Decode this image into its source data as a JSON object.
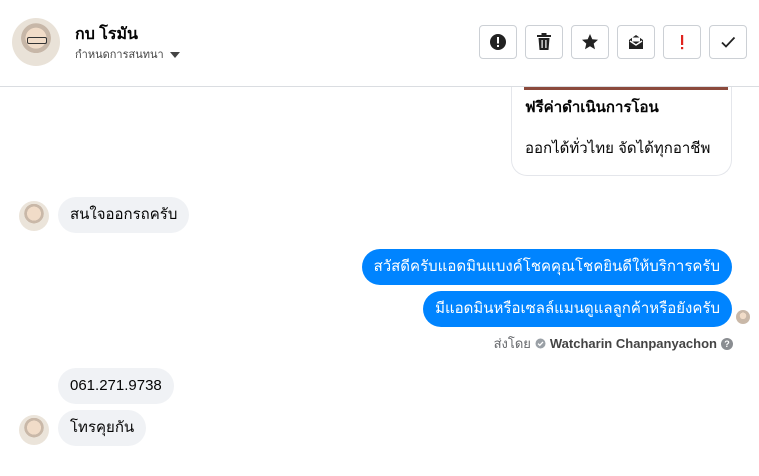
{
  "header": {
    "contact_name": "กบ โรมัน",
    "subtitle": "กำหนดการสนทนา",
    "tools": [
      "alert-circle-icon",
      "trash-icon",
      "star-icon",
      "mark-unread-icon",
      "important-icon",
      "check-icon"
    ]
  },
  "card": {
    "title": "ฟรีค่าดำเนินการโอน",
    "desc": "ออกได้ทั่วไทย จัดได้ทุกอาชีพ"
  },
  "messages": {
    "in_1": "สนใจออกรถครับ",
    "out_1": "สวัสดีครับแอดมินแบงค์โชคคุณโชคยินดีให้บริการครับ",
    "out_2": "มีแอดมินหรือเซลล์แมนดูแลลูกค้าหรือยังครับ",
    "in_2": "061.271.9738",
    "in_3": "โทรคุยกัน"
  },
  "sent_by": {
    "label": "ส่งโดย",
    "name": "Watcharin Chanpanyachon",
    "help": "?"
  },
  "colors": {
    "outgoing": "#0084ff",
    "incoming": "#f0f2f5",
    "important": "#e0241f"
  }
}
